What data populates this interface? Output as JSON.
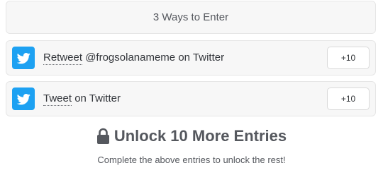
{
  "header": {
    "title": "3 Ways to Enter"
  },
  "entries": [
    {
      "icon": "twitter-icon",
      "action": "Retweet",
      "target": " @frogsolanameme on Twitter",
      "points": "+10"
    },
    {
      "icon": "twitter-icon",
      "action": "Tweet",
      "target": " on Twitter",
      "points": "+10"
    }
  ],
  "unlock": {
    "icon": "lock-icon",
    "title": "Unlock 10 More Entries",
    "subtitle": "Complete the above entries to unlock the rest!"
  },
  "colors": {
    "twitter_blue": "#1da1f2",
    "panel_bg": "#f7f7f7",
    "text": "#55585e"
  }
}
